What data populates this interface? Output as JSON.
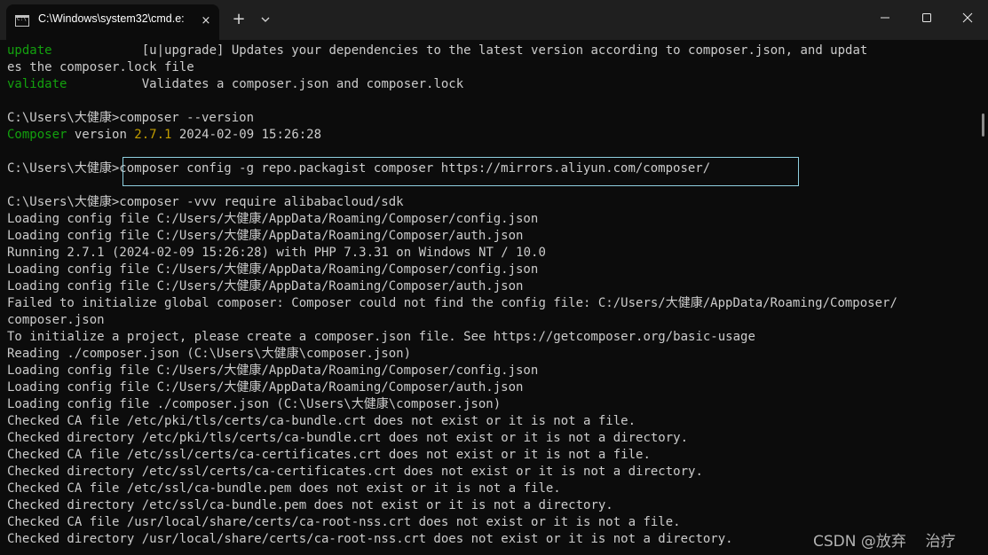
{
  "window": {
    "tab_title": "C:\\Windows\\system32\\cmd.e:",
    "tab_icon_text": "C:\\",
    "tab_close_icon": "×",
    "new_tab_icon": "+",
    "minimize_icon": "minimize-icon",
    "maximize_icon": "maximize-icon",
    "close_icon": "close-icon"
  },
  "terminal": {
    "update_cmd": "update",
    "update_desc": "[u|upgrade] Updates your dependencies to the latest version according to composer.json, and updat",
    "update_desc_cont": "es the composer.lock file",
    "validate_cmd": "validate",
    "validate_desc": "Validates a composer.json and composer.lock",
    "prompt1": "C:\\Users\\大健康>composer --version",
    "version_name": "Composer",
    "version_word": " version ",
    "version_number": "2.7.1",
    "version_date": " 2024-02-09 15:26:28",
    "prompt2_path": "C:\\Users\\大健康",
    "prompt2_cmd": ">composer config -g repo.packagist composer https://mirrors.aliyun.com/composer/",
    "prompt3": "C:\\Users\\大健康>composer -vvv require alibabacloud/sdk",
    "output": [
      "Loading config file C:/Users/大健康/AppData/Roaming/Composer/config.json",
      "Loading config file C:/Users/大健康/AppData/Roaming/Composer/auth.json",
      "Running 2.7.1 (2024-02-09 15:26:28) with PHP 7.3.31 on Windows NT / 10.0",
      "Loading config file C:/Users/大健康/AppData/Roaming/Composer/config.json",
      "Loading config file C:/Users/大健康/AppData/Roaming/Composer/auth.json",
      "Failed to initialize global composer: Composer could not find the config file: C:/Users/大健康/AppData/Roaming/Composer/",
      "composer.json",
      "To initialize a project, please create a composer.json file. See https://getcomposer.org/basic-usage",
      "Reading ./composer.json (C:\\Users\\大健康\\composer.json)",
      "Loading config file C:/Users/大健康/AppData/Roaming/Composer/config.json",
      "Loading config file C:/Users/大健康/AppData/Roaming/Composer/auth.json",
      "Loading config file ./composer.json (C:\\Users\\大健康\\composer.json)",
      "Checked CA file /etc/pki/tls/certs/ca-bundle.crt does not exist or it is not a file.",
      "Checked directory /etc/pki/tls/certs/ca-bundle.crt does not exist or it is not a directory.",
      "Checked CA file /etc/ssl/certs/ca-certificates.crt does not exist or it is not a file.",
      "Checked directory /etc/ssl/certs/ca-certificates.crt does not exist or it is not a directory.",
      "Checked CA file /etc/ssl/ca-bundle.pem does not exist or it is not a file.",
      "Checked directory /etc/ssl/ca-bundle.pem does not exist or it is not a directory.",
      "Checked CA file /usr/local/share/certs/ca-root-nss.crt does not exist or it is not a file.",
      "Checked directory /usr/local/share/certs/ca-root-nss.crt does not exist or it is not a directory."
    ]
  },
  "watermark": "CSDN @放弃    治疗",
  "colors": {
    "background": "#0c0c0c",
    "text": "#cccccc",
    "green": "#13a10e",
    "yellow": "#c19c00",
    "highlight_border": "#8fd0e0"
  }
}
